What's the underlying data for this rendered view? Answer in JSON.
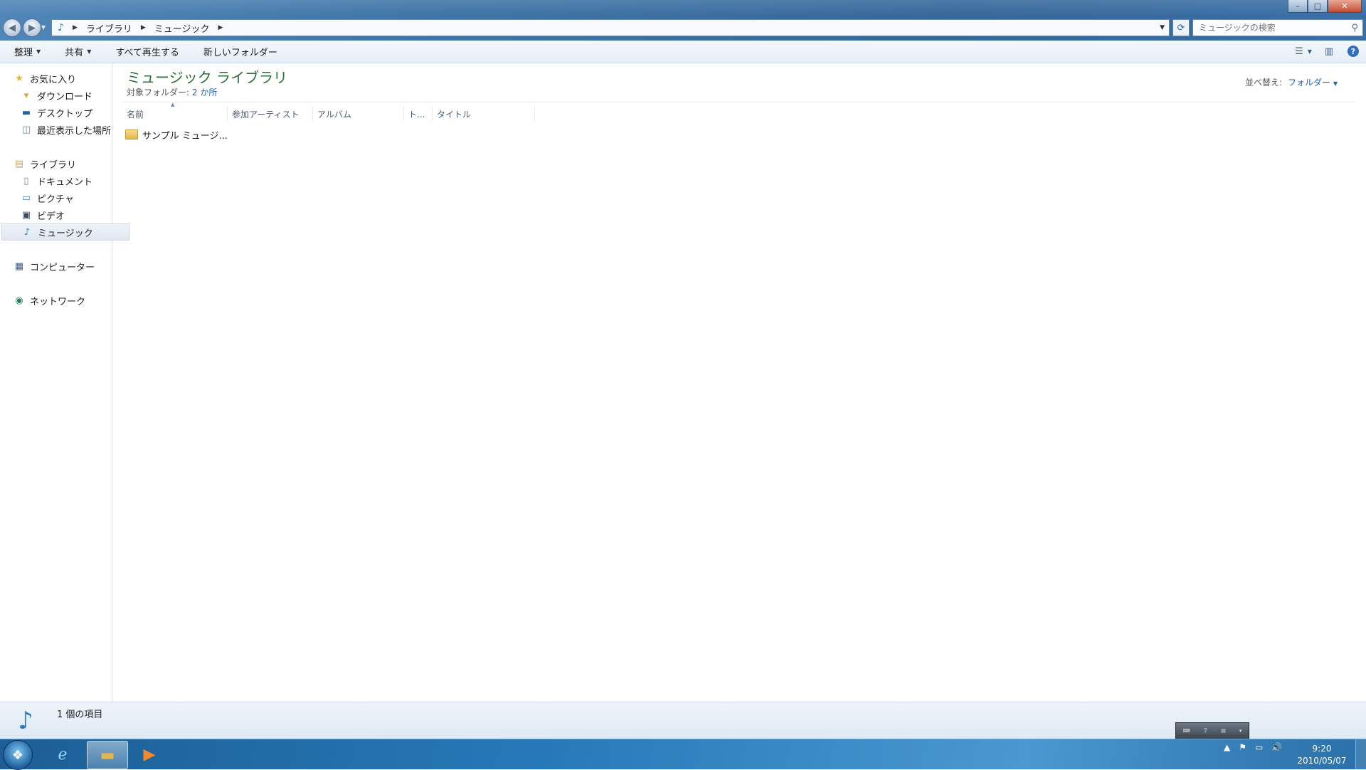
{
  "window": {
    "controls": {
      "minimize": "–",
      "maximize": "□",
      "close": "✕"
    }
  },
  "address": {
    "crumbs": [
      "ライブラリ",
      "ミュージック"
    ]
  },
  "search": {
    "placeholder": "ミュージックの検索"
  },
  "toolbar": {
    "organize": "整理",
    "share": "共有",
    "play_all": "すべて再生する",
    "new_folder": "新しいフォルダー"
  },
  "sidebar": {
    "favorites": {
      "label": "お気に入り",
      "items": [
        "ダウンロード",
        "デスクトップ",
        "最近表示した場所"
      ]
    },
    "libraries": {
      "label": "ライブラリ",
      "items": [
        "ドキュメント",
        "ピクチャ",
        "ビデオ",
        "ミュージック"
      ]
    },
    "computer": "コンピューター",
    "network": "ネットワーク"
  },
  "content": {
    "title": "ミュージック ライブラリ",
    "subtitle_label": "対象フォルダー:",
    "subtitle_link": "2 か所",
    "arrange_label": "並べ替え:",
    "arrange_value": "フォルダー",
    "columns": [
      "名前",
      "参加アーティスト",
      "アルバム",
      "ト...",
      "タイトル"
    ],
    "items": [
      {
        "name": "サンプル ミュージ..."
      }
    ]
  },
  "status": {
    "count": "1 個の項目"
  },
  "clock": {
    "time": "9:20",
    "date": "2010/05/07"
  },
  "colors": {
    "title_green": "#2b6f3a",
    "link_blue": "#1e5fb3",
    "taskbar": "#2679b8"
  }
}
